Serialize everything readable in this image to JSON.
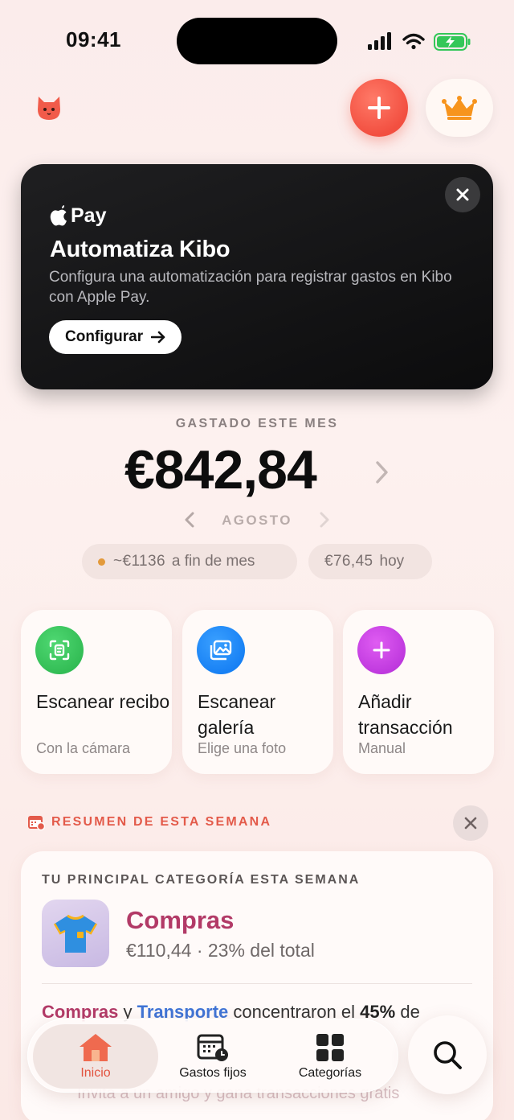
{
  "status_bar": {
    "time": "09:41"
  },
  "header": {
    "mascot_icon": "cat-mascot-icon",
    "add_icon": "plus-icon",
    "premium_icon": "crown-icon"
  },
  "promo": {
    "brand": "Pay",
    "title": "Automatiza Kibo",
    "description": "Configura una automatización para registrar gastos en Kibo con Apple Pay.",
    "cta_label": "Configurar"
  },
  "spending": {
    "label": "GASTADO ESTE MES",
    "amount": "€842,84",
    "month": "AGOSTO",
    "forecast_value": "~€1136",
    "forecast_text": "a fin de mes",
    "today_value": "€76,45",
    "today_text": "hoy"
  },
  "actions": [
    {
      "title": "Escanear recibo",
      "subtitle": "Con la cámara",
      "icon": "scan-receipt-icon",
      "color": "#34c759"
    },
    {
      "title": "Escanear galería",
      "subtitle": "Elige una foto",
      "icon": "photo-gallery-icon",
      "color": "#0a84ff"
    },
    {
      "title": "Añadir transacción",
      "subtitle": "Manual",
      "icon": "plus-icon",
      "color": "#c83ce0"
    }
  ],
  "weekly": {
    "heading": "RESUMEN DE ESTA SEMANA",
    "top_category_label": "TU PRINCIPAL CATEGORÍA ESTA SEMANA",
    "category_name": "Compras",
    "category_amount": "€110,44 · 23% del total",
    "insight_cat1": "Compras",
    "insight_and": " y ",
    "insight_cat2": "Transporte",
    "insight_mid": " concentraron el ",
    "insight_pct": "45%",
    "insight_end": " de",
    "invite_text": "Invita a un amigo y gana transacciones gratis"
  },
  "tabbar": {
    "tabs": [
      {
        "label": "Inicio",
        "icon": "home-icon"
      },
      {
        "label": "Gastos fijos",
        "icon": "calendar-clock-icon"
      },
      {
        "label": "Categorías",
        "icon": "grid-icon"
      }
    ],
    "search_icon": "search-icon"
  },
  "colors": {
    "accent": "#f24f40",
    "category": "#b23a67",
    "secondary_link": "#3f74d6"
  }
}
